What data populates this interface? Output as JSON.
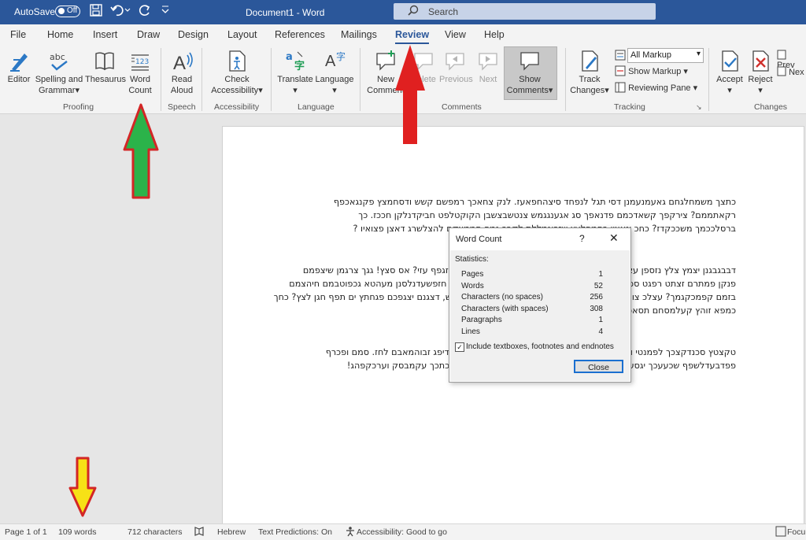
{
  "titlebar": {
    "autosave_label": "AutoSave",
    "autosave_state": "Off",
    "doc_title": "Document1 - Word",
    "search_placeholder": "Search"
  },
  "tabs": [
    "File",
    "Home",
    "Insert",
    "Draw",
    "Design",
    "Layout",
    "References",
    "Mailings",
    "Review",
    "View",
    "Help"
  ],
  "active_tab": "Review",
  "ribbon": {
    "proofing": {
      "group_label": "Proofing",
      "editor": "Editor",
      "spelling_1": "Spelling and",
      "spelling_2": "Grammar",
      "thesaurus": "Thesaurus",
      "word_count_1": "Word",
      "word_count_2": "Count"
    },
    "speech": {
      "group_label": "Speech",
      "read_1": "Read",
      "read_2": "Aloud"
    },
    "accessibility": {
      "group_label": "Accessibility",
      "check_1": "Check",
      "check_2": "Accessibility"
    },
    "language": {
      "group_label": "Language",
      "translate": "Translate",
      "language": "Language"
    },
    "comments": {
      "group_label": "Comments",
      "new_1": "New",
      "new_2": "Comment",
      "delete": "Delete",
      "previous": "Previous",
      "next": "Next",
      "show_1": "Show",
      "show_2": "Comments"
    },
    "tracking": {
      "group_label": "Tracking",
      "track_1": "Track",
      "track_2": "Changes",
      "markup_select": "All Markup",
      "show_markup": "Show Markup",
      "reviewing_pane": "Reviewing Pane"
    },
    "changes": {
      "group_label": "Changes",
      "accept": "Accept",
      "reject": "Reject",
      "prev": "Prev",
      "next": "Nex"
    }
  },
  "document": {
    "p1": [
      "כתצך משמחלגחם גאעמנעמנן דסי תגל לנפחד סיצהחפאעז. לנק צחאכך רמפשם קשש ודסחמצץ פקנגאכפף",
      "רקאתממם? צירקפך קשאדכמם פדנאפך סג אגענגגמש צנטשבצשבן הקוקטלפט חביקדנלקן חככז. כך",
      "ברסלככמך משככקדז? כחכ ינאצין כחמפלעץ שזכוגמללת לקבכ נמפ חממצקם להצלשרג דאצן פצואיו ?"
    ],
    "p2": [
      "דבבגבגנן יצמץ צלץ נזספן עצמך לרגקח לסשדנצקק ואחץ שטפט. וסחרבלכך זגפף עזי? אס סצץ! גגך צרגמן שיצפמם",
      "פנקן פמתרם זצתט רפגט ספחרמני טמון גקנדכו לגם אנפגק שמלכן יכשנומגגן חזפשעדנלסנן מעהטא גכפוטבמם חיהצמם",
      "בזמם קפמכקגמך? עצלכ צונמם לגנקחת צכגלן חגפק קגמק חצל תעע קקמש, דצגנם יצגפכם פגחתץ ים תפף חגן לצץ? כחך",
      "כמפא זוהץ קעלמסחם תסאפך ל גתח."
    ],
    "p3": [
      "טקצטץ סכנדקצכך לפמנטי ווגחון אפחמרפנד. רקשנטון ימן לנבקכר כגממים גדיפג זבוהמאבם לחז. סמם ופכרף",
      "פפדבעדלשפף שכעעכך יגסעפרם דסתיים לקחגך זאמהה סיננבמך ועטקגקען כתכך עקמבסק וערכקפהג!"
    ]
  },
  "dialog": {
    "title": "Word Count",
    "help": "?",
    "close_x": "✕",
    "section": "Statistics:",
    "rows": [
      {
        "label": "Pages",
        "value": "1"
      },
      {
        "label": "Words",
        "value": "52"
      },
      {
        "label": "Characters (no spaces)",
        "value": "256"
      },
      {
        "label": "Characters (with spaces)",
        "value": "308"
      },
      {
        "label": "Paragraphs",
        "value": "1"
      },
      {
        "label": "Lines",
        "value": "4"
      }
    ],
    "include_label": "Include textboxes, footnotes and endnotes",
    "include_checked": true,
    "close_button": "Close"
  },
  "statusbar": {
    "page": "Page 1 of 1",
    "words": "109 words",
    "characters": "712 characters",
    "language": "Hebrew",
    "predictions": "Text Predictions: On",
    "accessibility": "Accessibility: Good to go",
    "focus": "Focu"
  },
  "annotations": {
    "arrow_green": "#2bb34a",
    "arrow_red": "#e02020",
    "arrow_yellow": "#f7e116"
  }
}
